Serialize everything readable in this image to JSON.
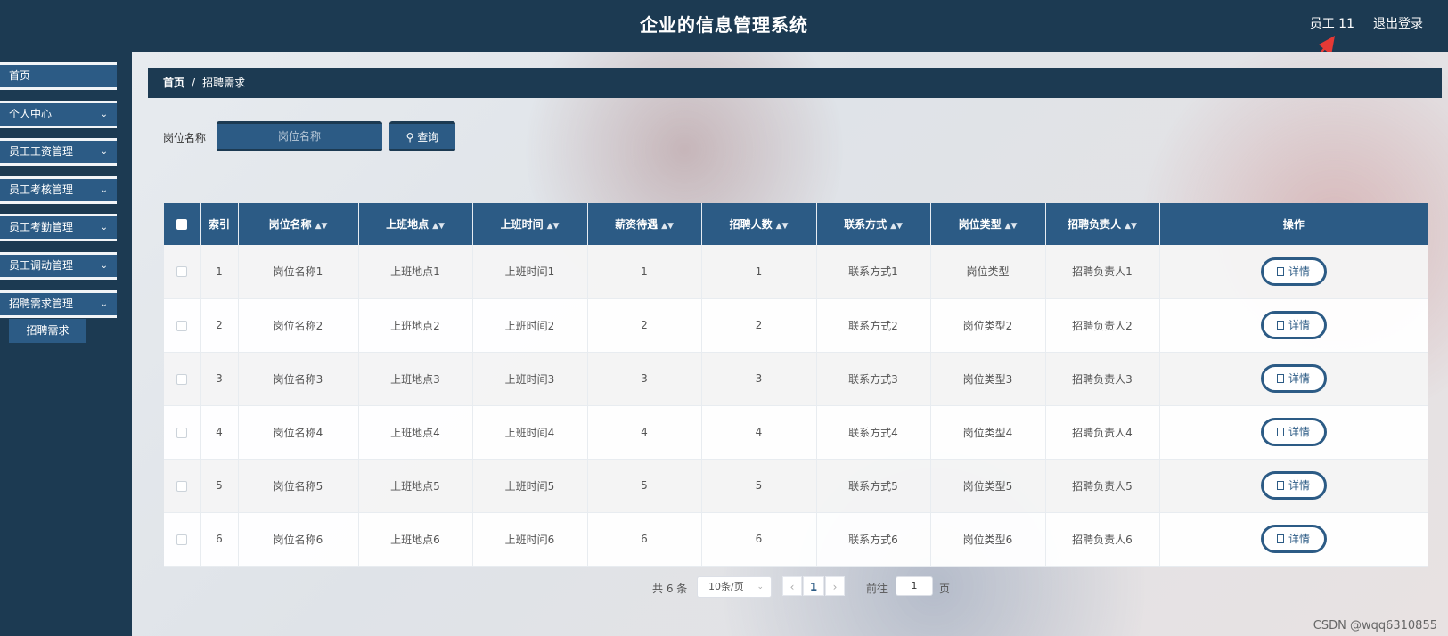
{
  "header": {
    "title": "企业的信息管理系统",
    "user_label": "员工 11",
    "logout_label": "退出登录"
  },
  "sidebar": {
    "items": [
      {
        "label": "首页"
      },
      {
        "label": "个人中心"
      },
      {
        "label": "员工工资管理"
      },
      {
        "label": "员工考核管理"
      },
      {
        "label": "员工考勤管理"
      },
      {
        "label": "员工调动管理"
      },
      {
        "label": "招聘需求管理"
      }
    ],
    "sub_item": "招聘需求"
  },
  "breadcrumb": {
    "home": "首页",
    "separator": "/",
    "current": "招聘需求"
  },
  "search": {
    "label": "岗位名称",
    "placeholder": "岗位名称",
    "button_label": "查询"
  },
  "table": {
    "headers": {
      "index": "索引",
      "position": "岗位名称",
      "location": "上班地点",
      "time": "上班时间",
      "salary": "薪资待遇",
      "count": "招聘人数",
      "contact": "联系方式",
      "type": "岗位类型",
      "manager": "招聘负责人",
      "action": "操作"
    },
    "rows": [
      {
        "index": "1",
        "position": "岗位名称1",
        "location": "上班地点1",
        "time": "上班时间1",
        "salary": "1",
        "count": "1",
        "contact": "联系方式1",
        "type": "岗位类型",
        "manager": "招聘负责人1"
      },
      {
        "index": "2",
        "position": "岗位名称2",
        "location": "上班地点2",
        "time": "上班时间2",
        "salary": "2",
        "count": "2",
        "contact": "联系方式2",
        "type": "岗位类型2",
        "manager": "招聘负责人2"
      },
      {
        "index": "3",
        "position": "岗位名称3",
        "location": "上班地点3",
        "time": "上班时间3",
        "salary": "3",
        "count": "3",
        "contact": "联系方式3",
        "type": "岗位类型3",
        "manager": "招聘负责人3"
      },
      {
        "index": "4",
        "position": "岗位名称4",
        "location": "上班地点4",
        "time": "上班时间4",
        "salary": "4",
        "count": "4",
        "contact": "联系方式4",
        "type": "岗位类型4",
        "manager": "招聘负责人4"
      },
      {
        "index": "5",
        "position": "岗位名称5",
        "location": "上班地点5",
        "time": "上班时间5",
        "salary": "5",
        "count": "5",
        "contact": "联系方式5",
        "type": "岗位类型5",
        "manager": "招聘负责人5"
      },
      {
        "index": "6",
        "position": "岗位名称6",
        "location": "上班地点6",
        "time": "上班时间6",
        "salary": "6",
        "count": "6",
        "contact": "联系方式6",
        "type": "岗位类型6",
        "manager": "招聘负责人6"
      }
    ],
    "detail_label": "详情"
  },
  "pagination": {
    "total": "共 6 条",
    "page_size": "10条/页",
    "current_page": "1",
    "goto_label": "前往",
    "goto_value": "1",
    "page_word": "页"
  },
  "watermark": "CSDN @wqq6310855",
  "colors": {
    "primary": "#2c5b85",
    "dark": "#1c3a52",
    "arrow": "#e53935"
  }
}
